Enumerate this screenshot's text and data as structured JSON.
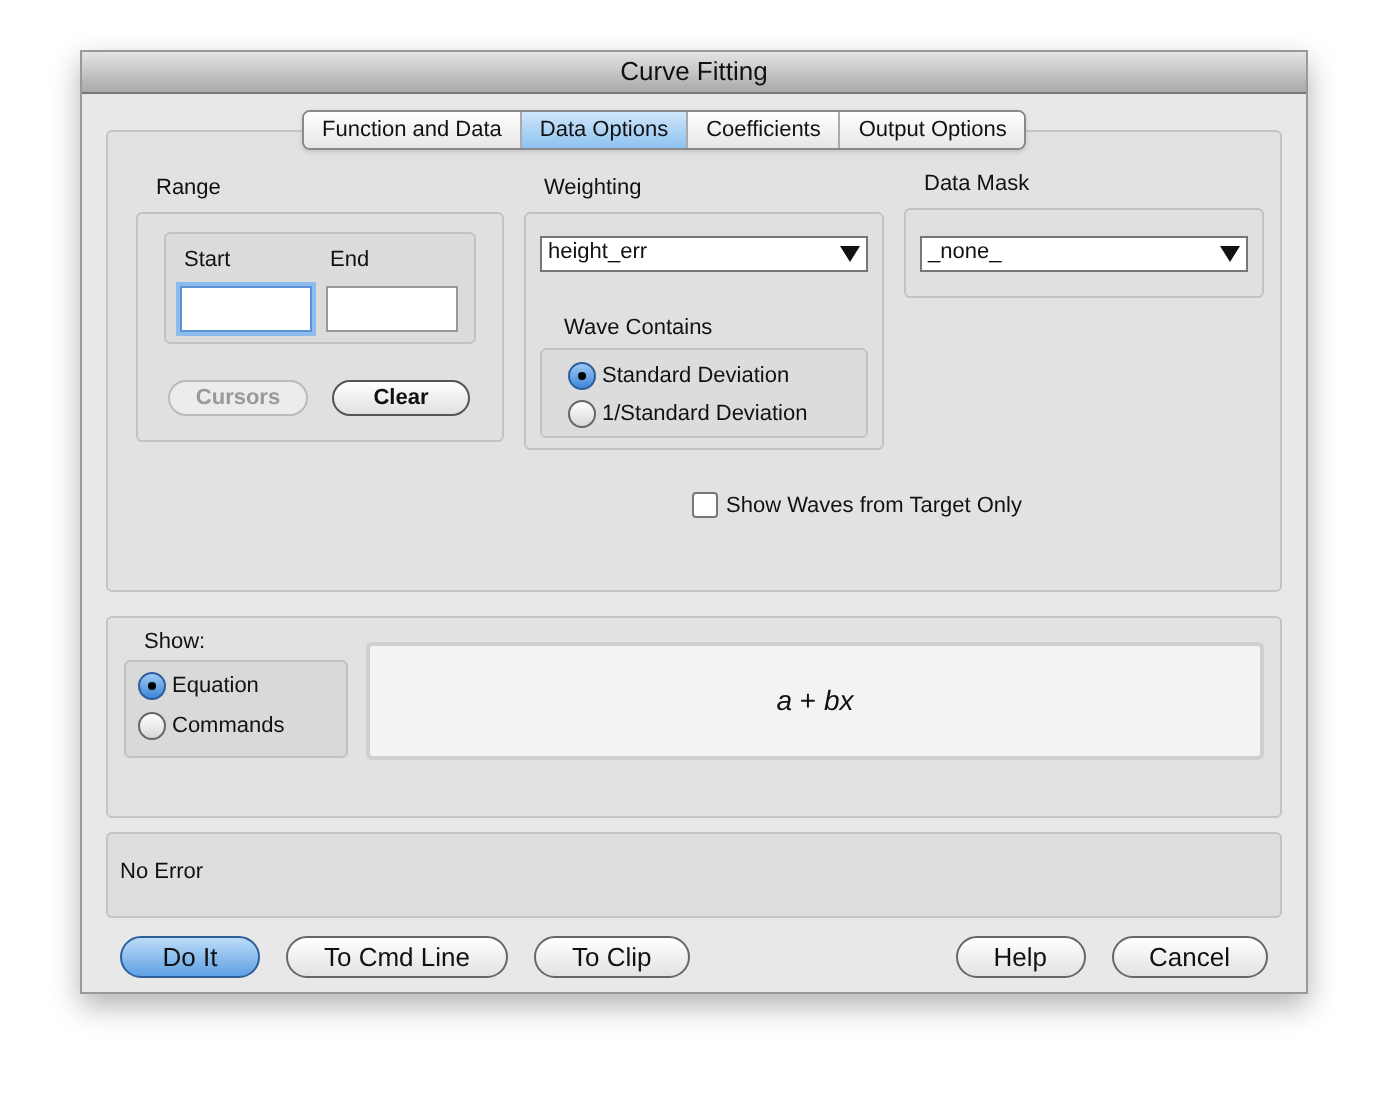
{
  "window": {
    "title": "Curve Fitting"
  },
  "tabs": [
    {
      "label": "Function and Data",
      "selected": false
    },
    {
      "label": "Data Options",
      "selected": true
    },
    {
      "label": "Coefficients",
      "selected": false
    },
    {
      "label": "Output Options",
      "selected": false
    }
  ],
  "range": {
    "title": "Range",
    "fields": [
      {
        "label": "Start",
        "focused": true
      },
      {
        "label": "End",
        "focused": false
      }
    ],
    "buttons": [
      {
        "label": "Cursors",
        "disabled": true
      },
      {
        "label": "Clear",
        "disabled": false
      }
    ]
  },
  "weighting": {
    "title": "Weighting",
    "value": "height_err",
    "wave_contains": {
      "title": "Wave Contains",
      "options": [
        {
          "label": "Standard Deviation",
          "selected": true
        },
        {
          "label": "1/Standard Deviation",
          "selected": false
        }
      ]
    }
  },
  "data_mask": {
    "title": "Data Mask",
    "value": "_none_"
  },
  "target_only": {
    "label": "Show Waves from Target Only",
    "checked": false
  },
  "show": {
    "title": "Show:",
    "options": [
      {
        "label": "Equation",
        "selected": true
      },
      {
        "label": "Commands",
        "selected": false
      }
    ],
    "equation": "*a* + *bx*"
  },
  "status": "No Error",
  "buttons": [
    {
      "label": "Do It",
      "default": true
    },
    {
      "label": "To Cmd Line",
      "default": false
    },
    {
      "label": "To Clip",
      "default": false
    },
    {
      "label": "Help",
      "default": false
    },
    {
      "label": "Cancel",
      "default": false
    }
  ]
}
